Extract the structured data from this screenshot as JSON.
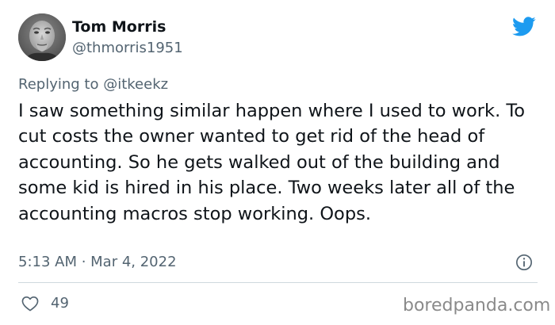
{
  "author": {
    "display_name": "Tom Morris",
    "handle": "@thmorris1951",
    "avatar_icon": "user-avatar-photo"
  },
  "brand": {
    "icon": "twitter-bird-icon",
    "color": "#1d9bf0"
  },
  "reply": {
    "prefix": "Replying to",
    "mention": "@itkeekz"
  },
  "tweet": {
    "text": "I saw something similar happen where I used to work. To cut costs the owner wanted to get rid of the head of accounting. So he gets walked out of the building and some kid is hired in his place. Two weeks later all of the accounting macros stop working. Oops.",
    "timestamp": "5:13 AM · Mar 4, 2022"
  },
  "actions": {
    "info_icon": "info-icon",
    "like_icon": "heart-icon",
    "like_count": "49"
  },
  "watermark": {
    "text": "boredpanda.com"
  },
  "colors": {
    "text_primary": "#0f1419",
    "text_secondary": "#536471",
    "divider": "#cfd9de"
  }
}
